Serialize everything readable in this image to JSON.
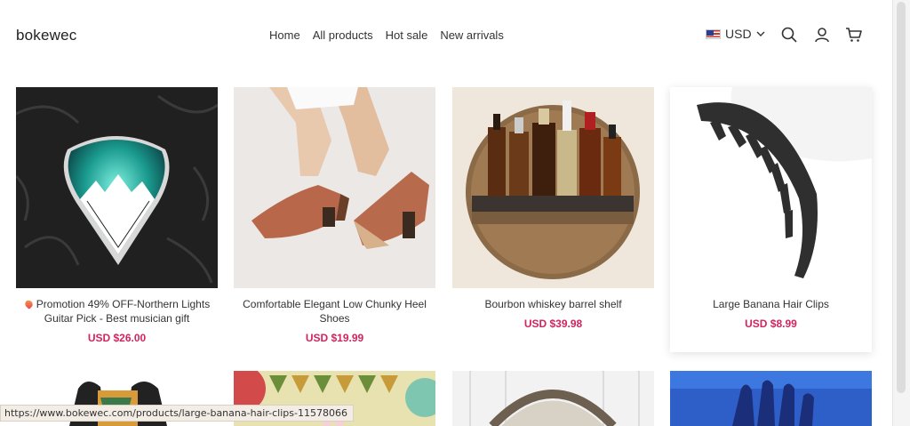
{
  "header": {
    "logo": "bokewec",
    "nav": [
      "Home",
      "All products",
      "Hot sale",
      "New arrivals"
    ],
    "currency": "USD"
  },
  "products": [
    {
      "title": "Promotion 49% OFF-Northern Lights Guitar Pick - Best musician gift",
      "price": "USD $26.00",
      "badge_icon": "heart-emoji-icon"
    },
    {
      "title": "Comfortable Elegant Low Chunky Heel Shoes",
      "price": "USD $19.99"
    },
    {
      "title": "Bourbon whiskey barrel shelf",
      "price": "USD $39.98"
    },
    {
      "title": "Large Banana Hair Clips",
      "price": "USD $8.99"
    }
  ],
  "status_url": "https://www.bokewec.com/products/large-banana-hair-clips-11578066",
  "colors": {
    "price": "#d0255e",
    "text": "#333333",
    "background": "#ffffff"
  }
}
